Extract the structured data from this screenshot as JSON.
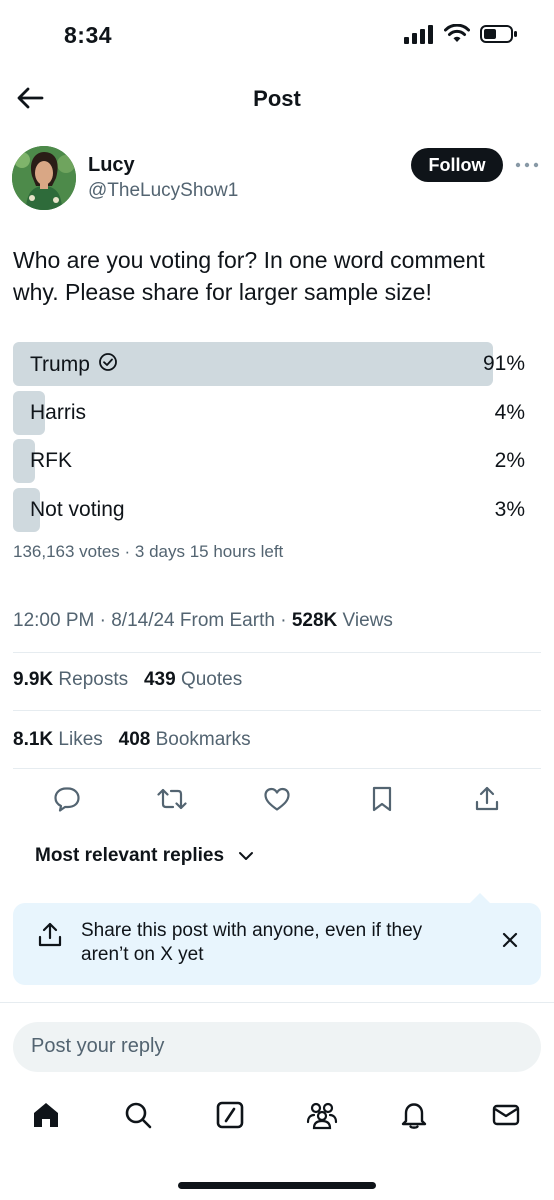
{
  "status_bar": {
    "time": "8:34"
  },
  "topbar": {
    "title": "Post"
  },
  "author": {
    "name": "Lucy",
    "handle": "@TheLucyShow1",
    "follow_label": "Follow"
  },
  "post": {
    "text": "Who are you voting for? In one word comment why. Please share for larger sample size!"
  },
  "poll": {
    "options": [
      {
        "label": "Trump",
        "percent_text": "91%",
        "fraction": 0.91,
        "selected": true
      },
      {
        "label": "Harris",
        "percent_text": "4%",
        "fraction": 0.04,
        "selected": false
      },
      {
        "label": "RFK",
        "percent_text": "2%",
        "fraction": 0.02,
        "selected": false
      },
      {
        "label": "Not voting",
        "percent_text": "3%",
        "fraction": 0.03,
        "selected": false
      }
    ],
    "meta": "136,163 votes · 3 days 15 hours left"
  },
  "post_meta": {
    "time": "12:00 PM",
    "date": "8/14/24",
    "source": "From Earth",
    "views_count": "528K",
    "views_label": "Views"
  },
  "stats": {
    "reposts_count": "9.9K",
    "reposts_label": "Reposts",
    "quotes_count": "439",
    "quotes_label": "Quotes",
    "likes_count": "8.1K",
    "likes_label": "Likes",
    "bookmarks_count": "408",
    "bookmarks_label": "Bookmarks"
  },
  "replies_sort": {
    "label": "Most relevant replies"
  },
  "share_card": {
    "text": "Share this post with anyone, even if they aren’t on X yet"
  },
  "reply": {
    "placeholder": "Post your reply"
  },
  "colors": {
    "text": "#0f1419",
    "secondary": "#536471",
    "poll_bar": "#cfd9de",
    "share_card_bg": "#e8f5fd",
    "reply_box_bg": "#eff3f4"
  },
  "icons": {
    "status": [
      "cellular-signal-icon",
      "wifi-icon",
      "battery-icon"
    ],
    "actions": [
      "reply-icon",
      "repost-icon",
      "like-icon",
      "bookmark-icon",
      "share-icon"
    ],
    "tabs": [
      "home-icon",
      "search-icon",
      "grok-icon",
      "communities-icon",
      "notifications-icon",
      "messages-icon"
    ]
  }
}
